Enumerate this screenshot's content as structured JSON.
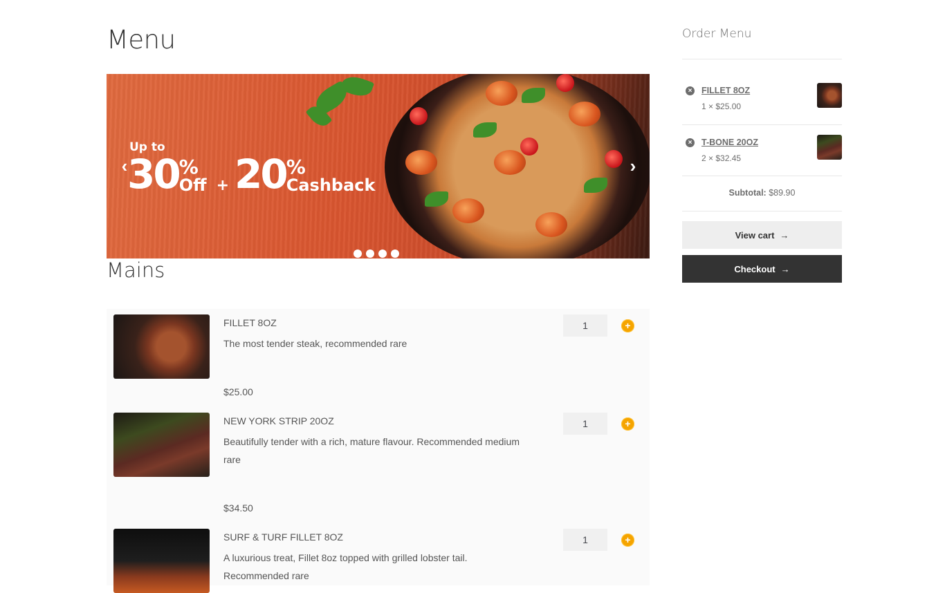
{
  "page": {
    "title": "Menu"
  },
  "banner": {
    "promo_upto": "Up to",
    "promo_pct1": "30",
    "promo_pct_sign1": "%",
    "promo_off": "Off",
    "promo_plus": "+",
    "promo_pct2": "20",
    "promo_pct_sign2": "%",
    "promo_cashback": "Cashback",
    "prev_icon": "‹",
    "next_icon": "›",
    "slide_count": 4
  },
  "section": {
    "title": "Mains"
  },
  "products": [
    {
      "name": "FILLET 8OZ",
      "description": "The most tender steak, recommended rare",
      "price": "$25.00",
      "qty": "1",
      "add_icon": "+"
    },
    {
      "name": "NEW YORK STRIP 20OZ",
      "description": "Beautifully tender with a rich, mature flavour. Recommended medium rare",
      "price": "$34.50",
      "qty": "1",
      "add_icon": "+"
    },
    {
      "name": "SURF & TURF FILLET 8OZ",
      "description": "A luxurious treat, Fillet 8oz topped with grilled lobster tail. Recommended rare",
      "price": "",
      "qty": "1",
      "add_icon": "+"
    }
  ],
  "sidebar": {
    "title": "Order Menu",
    "cart_items": [
      {
        "name": "FILLET 8OZ",
        "qty_price": "1 × $25.00",
        "remove_icon": "×"
      },
      {
        "name": "T-BONE 20OZ",
        "qty_price": "2 × $32.45",
        "remove_icon": "×"
      }
    ],
    "subtotal_label": "Subtotal:",
    "subtotal_value": "$89.90",
    "view_cart_label": "View cart",
    "checkout_label": "Checkout",
    "arrow_icon": "→"
  },
  "colors": {
    "accent": "#f5a400",
    "dark": "#333333",
    "banner": "#d9552f"
  }
}
